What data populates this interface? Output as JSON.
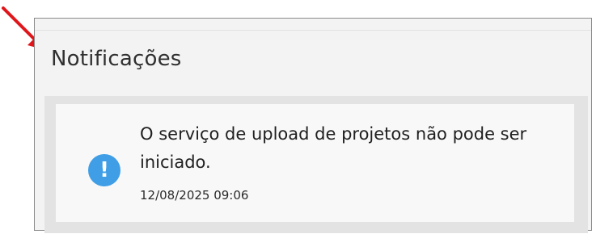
{
  "panel": {
    "title": "Notificações"
  },
  "notifications": [
    {
      "icon": "exclamation-info-icon",
      "icon_glyph": "!",
      "message": "O serviço de upload de projetos não pode ser iniciado.",
      "timestamp": "12/08/2025 09:06"
    }
  ],
  "colors": {
    "annotation_arrow": "#e0161b",
    "info_icon": "#3f9ee6",
    "panel_background": "#f3f3f3",
    "notification_group_background": "#e3e3e3",
    "notification_card_background": "#f8f8f8"
  }
}
